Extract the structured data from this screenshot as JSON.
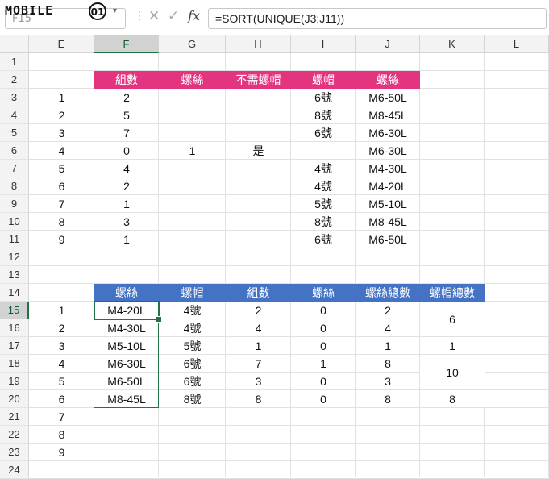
{
  "formula_bar": {
    "name_box": "F15",
    "logo": "MOBILE",
    "logo_badge": "01",
    "cancel_icon": "✕",
    "enter_icon": "✓",
    "fx_label": "fx",
    "formula": "=SORT(UNIQUE(J3:J11))"
  },
  "columns": [
    "E",
    "F",
    "G",
    "H",
    "I",
    "J",
    "K",
    "L"
  ],
  "selected_column": "F",
  "rows": [
    "1",
    "2",
    "3",
    "4",
    "5",
    "6",
    "7",
    "8",
    "9",
    "10",
    "11",
    "12",
    "13",
    "14",
    "15",
    "16",
    "17",
    "18",
    "19",
    "20",
    "21",
    "22",
    "23",
    "24"
  ],
  "selected_row": "15",
  "table1": {
    "headers": [
      "組數",
      "螺絲",
      "不需螺帽",
      "螺帽",
      "螺絲"
    ],
    "rows": [
      {
        "E": "1",
        "F": "2",
        "G": "",
        "H": "",
        "I": "6號",
        "J": "M6-50L"
      },
      {
        "E": "2",
        "F": "5",
        "G": "",
        "H": "",
        "I": "8號",
        "J": "M8-45L"
      },
      {
        "E": "3",
        "F": "7",
        "G": "",
        "H": "",
        "I": "6號",
        "J": "M6-30L"
      },
      {
        "E": "4",
        "F": "0",
        "G": "1",
        "H": "是",
        "I": "",
        "J": "M6-30L"
      },
      {
        "E": "5",
        "F": "4",
        "G": "",
        "H": "",
        "I": "4號",
        "J": "M4-30L"
      },
      {
        "E": "6",
        "F": "2",
        "G": "",
        "H": "",
        "I": "4號",
        "J": "M4-20L"
      },
      {
        "E": "7",
        "F": "1",
        "G": "",
        "H": "",
        "I": "5號",
        "J": "M5-10L"
      },
      {
        "E": "8",
        "F": "3",
        "G": "",
        "H": "",
        "I": "8號",
        "J": "M8-45L"
      },
      {
        "E": "9",
        "F": "1",
        "G": "",
        "H": "",
        "I": "6號",
        "J": "M6-50L"
      }
    ]
  },
  "table2": {
    "headers": [
      "螺絲",
      "螺帽",
      "組數",
      "螺絲",
      "螺絲總數",
      "螺帽總數"
    ],
    "rows": [
      {
        "E": "1",
        "F": "M4-20L",
        "G": "4號",
        "H": "2",
        "I": "0",
        "J": "2"
      },
      {
        "E": "2",
        "F": "M4-30L",
        "G": "4號",
        "H": "4",
        "I": "0",
        "J": "4"
      },
      {
        "E": "3",
        "F": "M5-10L",
        "G": "5號",
        "H": "1",
        "I": "0",
        "J": "1"
      },
      {
        "E": "4",
        "F": "M6-30L",
        "G": "6號",
        "H": "7",
        "I": "1",
        "J": "8"
      },
      {
        "E": "5",
        "F": "M6-50L",
        "G": "6號",
        "H": "3",
        "I": "0",
        "J": "3"
      },
      {
        "E": "6",
        "F": "M8-45L",
        "G": "8號",
        "H": "8",
        "I": "0",
        "J": "8"
      }
    ],
    "k_merged": [
      "6",
      "1",
      "10",
      "8"
    ],
    "extra_e": [
      "7",
      "8",
      "9"
    ]
  }
}
